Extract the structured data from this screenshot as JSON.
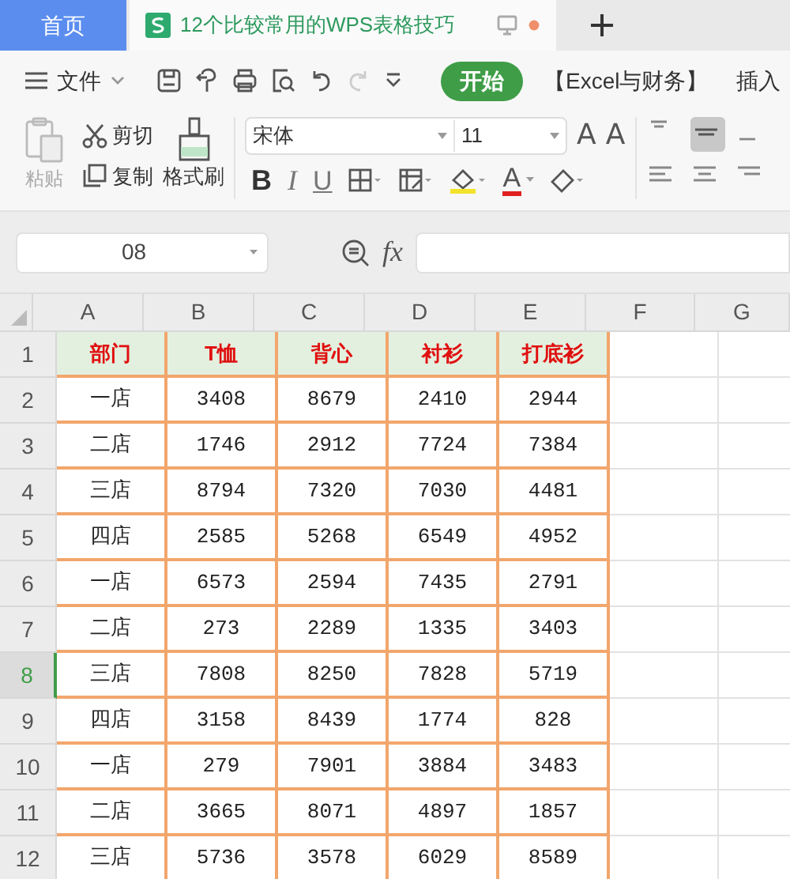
{
  "tabs": [
    {
      "label": "首页",
      "kind": "home",
      "selected": false
    },
    {
      "label": "12个比较常用的WPS表格技巧",
      "kind": "document",
      "selected": true
    }
  ],
  "menu": {
    "file": "文件",
    "ribbon_tabs": [
      {
        "label": "开始",
        "selected": true
      },
      {
        "label": "【Excel与财务】",
        "selected": false
      },
      {
        "label": "插入",
        "selected": false
      }
    ]
  },
  "ribbon": {
    "paste": "粘贴",
    "cut": "剪切",
    "copy": "复制",
    "format_painter": "格式刷",
    "font": "宋体",
    "font_size": "11",
    "grow_font": "A",
    "shrink_font": "A",
    "bold": "B",
    "italic": "I",
    "underline": "U",
    "font_color": "A"
  },
  "formula_bar": {
    "name_box": "08",
    "fx": "fx"
  },
  "columns": [
    "A",
    "B",
    "C",
    "D",
    "E",
    "F",
    "G"
  ],
  "rows": [
    {
      "number": "1",
      "kind": "header",
      "selected": false,
      "cells": [
        "部门",
        "T恤",
        "背心",
        "衬衫",
        "打底衫"
      ]
    },
    {
      "number": "2",
      "kind": "data",
      "selected": false,
      "cells": [
        "一店",
        "3408",
        "8679",
        "2410",
        "2944"
      ]
    },
    {
      "number": "3",
      "kind": "data",
      "selected": false,
      "cells": [
        "二店",
        "1746",
        "2912",
        "7724",
        "7384"
      ]
    },
    {
      "number": "4",
      "kind": "data",
      "selected": false,
      "cells": [
        "三店",
        "8794",
        "7320",
        "7030",
        "4481"
      ]
    },
    {
      "number": "5",
      "kind": "data",
      "selected": false,
      "cells": [
        "四店",
        "2585",
        "5268",
        "6549",
        "4952"
      ]
    },
    {
      "number": "6",
      "kind": "data",
      "selected": false,
      "cells": [
        "一店",
        "6573",
        "2594",
        "7435",
        "2791"
      ]
    },
    {
      "number": "7",
      "kind": "data",
      "selected": false,
      "cells": [
        "二店",
        "273",
        "2289",
        "1335",
        "3403"
      ]
    },
    {
      "number": "8",
      "kind": "data",
      "selected": true,
      "cells": [
        "三店",
        "7808",
        "8250",
        "7828",
        "5719"
      ]
    },
    {
      "number": "9",
      "kind": "data",
      "selected": false,
      "cells": [
        "四店",
        "3158",
        "8439",
        "1774",
        "828"
      ]
    },
    {
      "number": "10",
      "kind": "data",
      "selected": false,
      "cells": [
        "一店",
        "279",
        "7901",
        "3884",
        "3483"
      ]
    },
    {
      "number": "11",
      "kind": "data",
      "selected": false,
      "cells": [
        "二店",
        "3665",
        "8071",
        "4897",
        "1857"
      ]
    },
    {
      "number": "12",
      "kind": "data",
      "selected": false,
      "cells": [
        "三店",
        "5736",
        "3578",
        "6029",
        "8589"
      ]
    }
  ]
}
